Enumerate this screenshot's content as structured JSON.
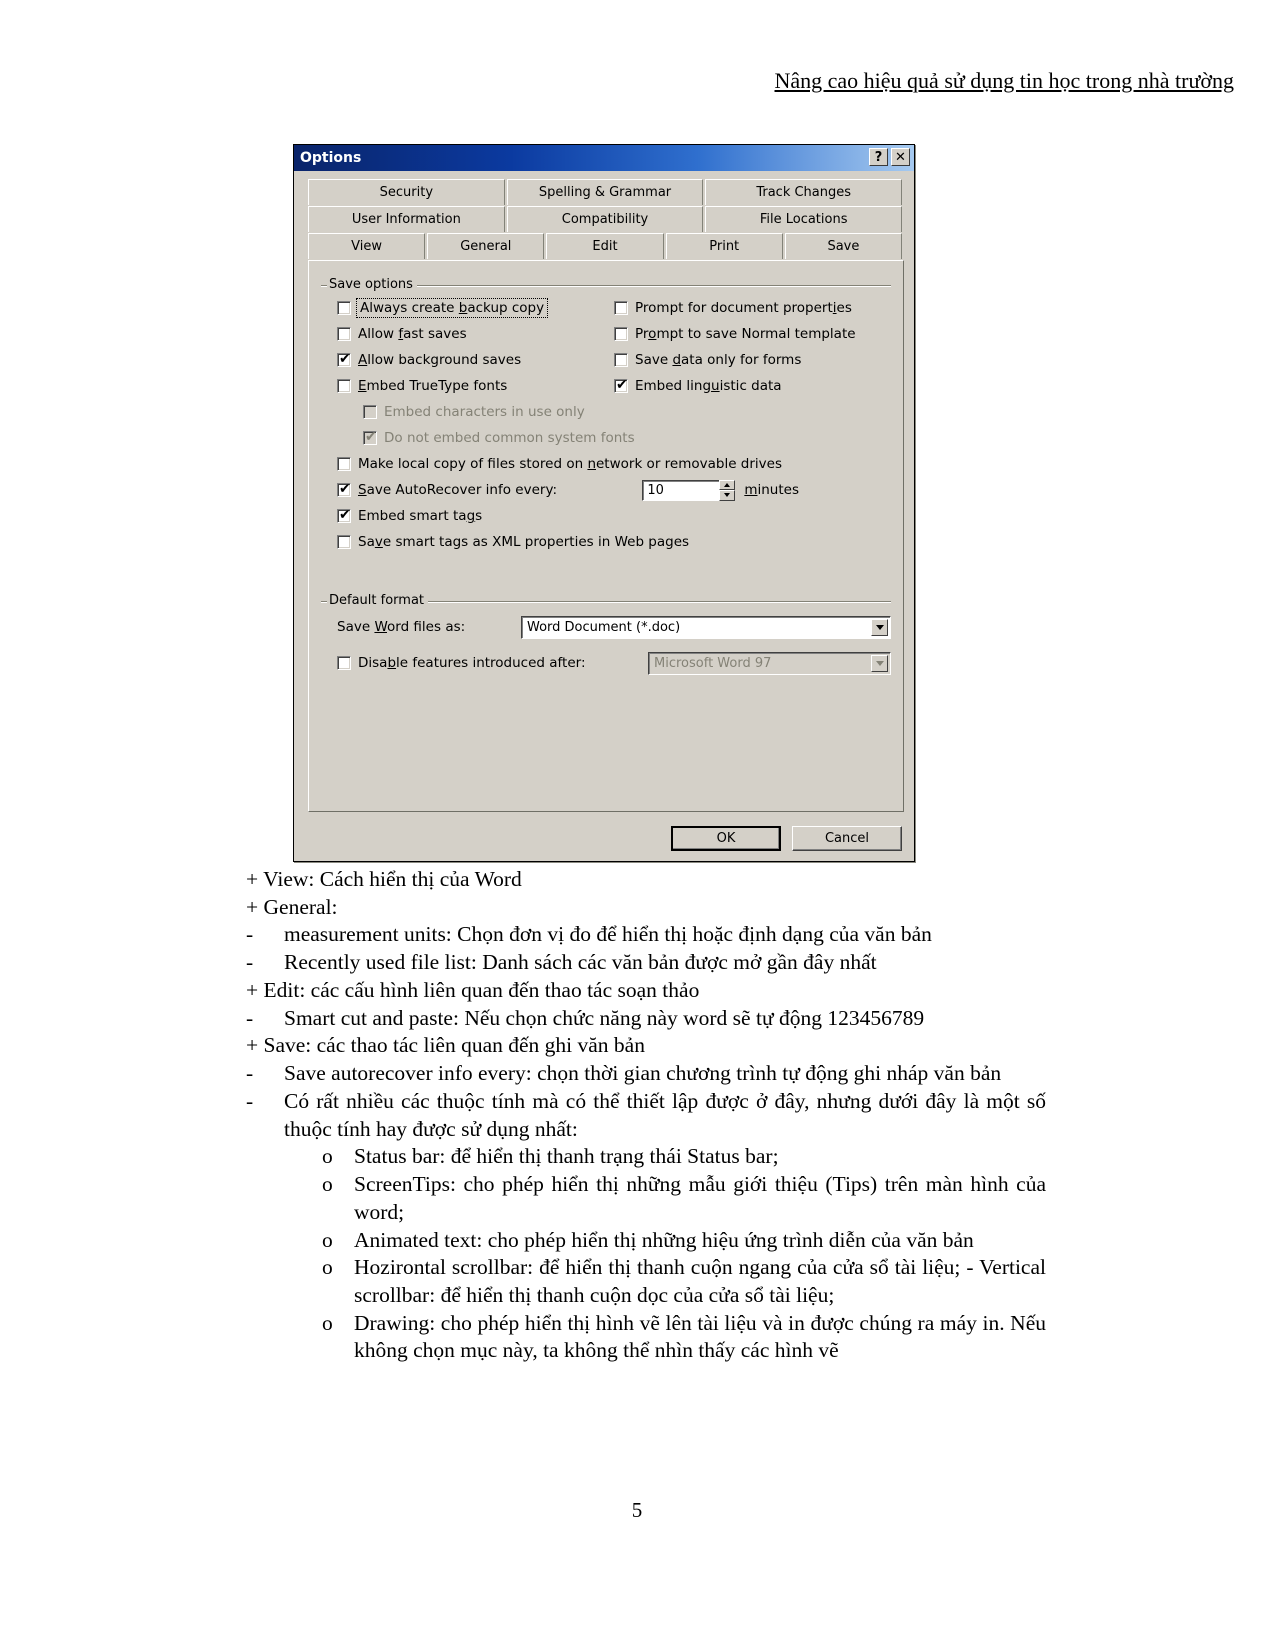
{
  "document": {
    "header": "Nâng cao hiệu quả sử dụng tin học trong nhà trường",
    "page_number": "5"
  },
  "dialog": {
    "title": "Options",
    "help_button": "?",
    "close_button": "✕",
    "tabs": {
      "row1": [
        {
          "label": "Security",
          "active": false
        },
        {
          "label": "Spelling & Grammar",
          "active": false
        },
        {
          "label": "Track Changes",
          "active": false
        }
      ],
      "row2": [
        {
          "label": "User Information",
          "active": false
        },
        {
          "label": "Compatibility",
          "active": false
        },
        {
          "label": "File Locations",
          "active": false
        }
      ],
      "row3": [
        {
          "label": "View",
          "active": false
        },
        {
          "label": "General",
          "active": false
        },
        {
          "label": "Edit",
          "active": false
        },
        {
          "label": "Print",
          "active": false
        },
        {
          "label": "Save",
          "active": true
        }
      ]
    },
    "save_options": {
      "group_title": "Save options",
      "left_column": [
        {
          "label": "Always create backup copy",
          "checked": false,
          "disabled": false,
          "focused": true
        },
        {
          "label": "Allow fast saves",
          "checked": false,
          "disabled": false,
          "focused": false
        },
        {
          "label": "Allow background saves",
          "checked": true,
          "disabled": false,
          "focused": false
        },
        {
          "label": "Embed TrueType fonts",
          "checked": false,
          "disabled": false,
          "focused": false
        }
      ],
      "right_column": [
        {
          "label": "Prompt for document properties",
          "checked": false,
          "disabled": false
        },
        {
          "label": "Prompt to save Normal template",
          "checked": false,
          "disabled": false
        },
        {
          "label": "Save data only for forms",
          "checked": false,
          "disabled": false
        },
        {
          "label": "Embed linguistic data",
          "checked": true,
          "disabled": false
        }
      ],
      "sub_options": [
        {
          "label": "Embed characters in use only",
          "checked": false,
          "disabled": true
        },
        {
          "label": "Do not embed common system fonts",
          "checked": true,
          "disabled": true
        }
      ],
      "full_width": [
        {
          "label": "Make local copy of files stored on network or removable drives",
          "checked": false,
          "disabled": false
        }
      ],
      "autorecover": {
        "label": "Save AutoRecover info every:",
        "checked": true,
        "value": "10",
        "units": "minutes"
      },
      "tail": [
        {
          "label": "Embed smart tags",
          "checked": true,
          "disabled": false
        },
        {
          "label": "Save smart tags as XML properties in Web pages",
          "checked": false,
          "disabled": false
        }
      ]
    },
    "default_format": {
      "group_title": "Default format",
      "save_as_label": "Save Word files as:",
      "save_as_value": "Word Document (*.doc)",
      "disable_features_label": "Disable features introduced after:",
      "disable_features_checked": false,
      "disable_features_value": "Microsoft Word 97",
      "disable_features_disabled": true
    },
    "buttons": {
      "ok": "OK",
      "cancel": "Cancel"
    }
  },
  "body": [
    {
      "level": 0,
      "text": "+ View: Cách hiển thị của Word"
    },
    {
      "level": 0,
      "text": "+ General:"
    },
    {
      "level": 1,
      "bullet": "-",
      "text": "measurement units: Chọn đơn vị đo để hiển thị hoặc định dạng của văn bản"
    },
    {
      "level": 1,
      "bullet": "-",
      "text": "Recently used file list: Danh sách các văn bản được mở gần đây nhất"
    },
    {
      "level": 0,
      "text": "+ Edit: các cấu hình liên quan đến thao tác soạn thảo"
    },
    {
      "level": 1,
      "bullet": "-",
      "text": "Smart cut and paste: Nếu chọn chức năng này word sẽ tự động 123456789"
    },
    {
      "level": 0,
      "text": "+ Save: các thao tác liên quan đến ghi văn bản"
    },
    {
      "level": 1,
      "bullet": "-",
      "text": "Save autorecover info every: chọn thời gian chương trình tự động ghi nháp văn bản"
    },
    {
      "level": 1,
      "bullet": "-",
      "text": "Có rất nhiều các thuộc tính mà có thể thiết lập được ở đây, nhưng dưới đây là một số thuộc tính hay được sử dụng nhất:"
    },
    {
      "level": 2,
      "bullet": "o",
      "text": "Status bar: để hiển thị thanh trạng thái Status bar;"
    },
    {
      "level": 2,
      "bullet": "o",
      "text": "ScreenTips: cho phép hiển thị những mẫu giới thiệu (Tips) trên màn hình của word;"
    },
    {
      "level": 2,
      "bullet": "o",
      "text": "Animated text: cho phép hiển thị những hiệu ứng trình diễn của văn bản"
    },
    {
      "level": 2,
      "bullet": "o",
      "text": "Hozirontal scrollbar: để hiển thị thanh cuộn ngang của cửa sổ tài liệu; - Vertical scrollbar: để hiển thị thanh cuộn dọc của cửa sổ tài liệu;"
    },
    {
      "level": 2,
      "bullet": "o",
      "text": "Drawing: cho phép hiển thị hình vẽ lên tài liệu và in được chúng ra máy in. Nếu không chọn mục này, ta không thể nhìn thấy các hình vẽ"
    }
  ]
}
